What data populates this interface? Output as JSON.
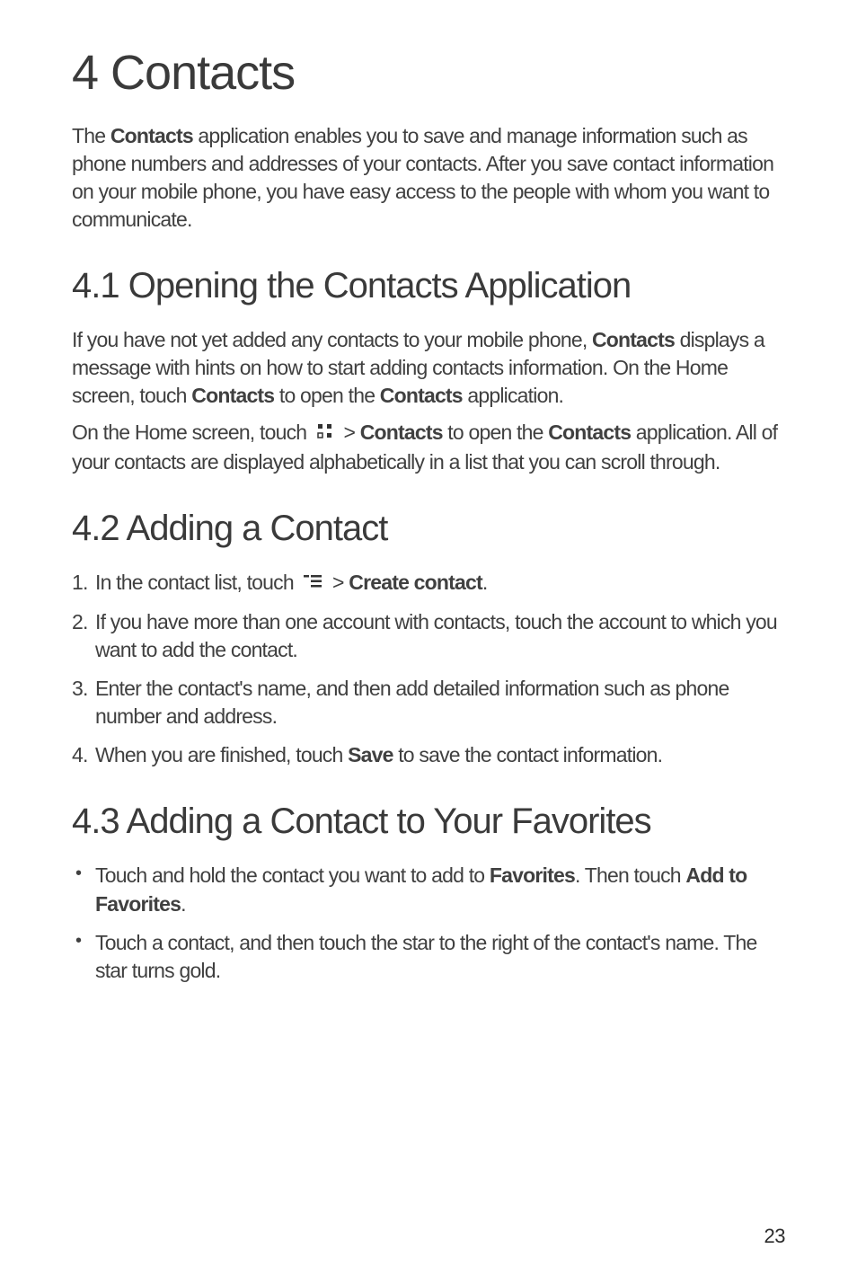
{
  "chapter": {
    "title": "4  Contacts"
  },
  "intro": {
    "text_before": "The ",
    "bold1": "Contacts",
    "text_after": " application enables you to save and manage information such as phone numbers and addresses of your contacts. After you save contact information on your mobile phone, you have easy access to the people with whom you want to communicate."
  },
  "section41": {
    "title": "4.1  Opening the Contacts Application",
    "para1_a": "If  you have not yet added any contacts to your mobile phone, ",
    "para1_b1": "Contacts",
    "para1_c": " displays a message with hints on how to start adding contacts information. On the Home screen, touch ",
    "para1_b2": "Contacts",
    "para1_d": " to open the ",
    "para1_b3": "Contacts",
    "para1_e": " application.",
    "para2_a": "On the Home screen, touch ",
    "para2_b": " > ",
    "para2_b1": "Contacts",
    "para2_c": " to open the ",
    "para2_b2": "Contacts",
    "para2_d": " application. All of your contacts are displayed alphabetically in a list that you can scroll through."
  },
  "section42": {
    "title": "4.2  Adding a Contact",
    "step1_a": "In the contact list, touch ",
    "step1_b": " > ",
    "step1_bold": "Create contact",
    "step1_c": ".",
    "step2": "If you have more than one account with contacts, touch the account to which you want to add the contact.",
    "step3": "Enter the contact's name, and then add detailed information such as phone number and address.",
    "step4_a": "When you are finished, touch ",
    "step4_bold": "Save",
    "step4_b": " to save the contact information."
  },
  "section43": {
    "title": "4.3  Adding a Contact to Your Favorites",
    "bullet1_a": "Touch and hold the contact you want to add to ",
    "bullet1_b1": "Favorites",
    "bullet1_b": ". Then touch ",
    "bullet1_b2": "Add to Favorites",
    "bullet1_c": ".",
    "bullet2": "Touch a contact, and then touch the star to the right of the contact's name. The star turns gold."
  },
  "pageNumber": "23"
}
